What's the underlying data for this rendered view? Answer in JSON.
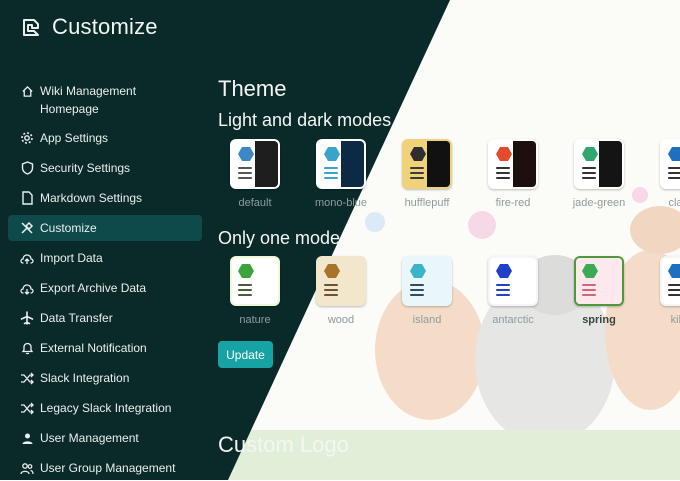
{
  "app": {
    "title": "Customize"
  },
  "sidebar": {
    "items": [
      {
        "label": "Wiki Management Homepage",
        "icon": "home-icon"
      },
      {
        "label": "App Settings",
        "icon": "gear-icon"
      },
      {
        "label": "Security Settings",
        "icon": "shield-icon"
      },
      {
        "label": "Markdown Settings",
        "icon": "file-icon"
      },
      {
        "label": "Customize",
        "icon": "tools-icon",
        "active": true
      },
      {
        "label": "Import Data",
        "icon": "cloud-upload-icon"
      },
      {
        "label": "Export Archive Data",
        "icon": "cloud-download-icon"
      },
      {
        "label": "Data Transfer",
        "icon": "airplane-icon"
      },
      {
        "label": "External Notification",
        "icon": "bell-icon"
      },
      {
        "label": "Slack Integration",
        "icon": "shuffle-icon"
      },
      {
        "label": "Legacy Slack Integration",
        "icon": "shuffle-icon"
      },
      {
        "label": "User Management",
        "icon": "user-icon"
      },
      {
        "label": "User Group Management",
        "icon": "users-icon"
      }
    ]
  },
  "main": {
    "theme_heading": "Theme",
    "light_dark_heading": "Light and dark modes",
    "one_mode_heading": "Only one mode",
    "custom_logo_heading": "Custom Logo",
    "update_label": "Update",
    "light_dark_themes": [
      {
        "name": "default",
        "hex": "#3d87c6",
        "left": "#ffffff",
        "right": "#1e1e1e",
        "line": "#555555"
      },
      {
        "name": "mono-blue",
        "hex": "#3aa3c9",
        "left": "#ffffff",
        "right": "#0c2a45",
        "line": "#3aa3c9"
      },
      {
        "name": "hufflepuff",
        "hex": "#2e2e2e",
        "left": "#f0d27a",
        "right": "#111111",
        "line": "#3a3a3a"
      },
      {
        "name": "fire-red",
        "hex": "#e34b2c",
        "left": "#ffffff",
        "right": "#1e0f0f",
        "line": "#333333"
      },
      {
        "name": "jade-green",
        "hex": "#2fa76f",
        "left": "#ffffff",
        "right": "#141414",
        "line": "#333333"
      },
      {
        "name": "classic",
        "hex": "#1f6fc1",
        "left": "#ffffff",
        "right": "#1c2b3b",
        "line": "#333333"
      }
    ],
    "one_mode_themes": [
      {
        "name": "nature",
        "hex": "#3ea33b",
        "left": "#ffffff",
        "right": "#ffffff",
        "line": "#4a5a3a",
        "bg": "#eef8d8"
      },
      {
        "name": "wood",
        "hex": "#a8742a",
        "left": "#f2e6cc",
        "right": "#f2e6cc",
        "line": "#6d5230",
        "bg": "#f2e6cc"
      },
      {
        "name": "island",
        "hex": "#3bb3c8",
        "left": "#e9f7fa",
        "right": "#e9f7fa",
        "line": "#2f4f5f",
        "bg": "#e9f7fa"
      },
      {
        "name": "antarctic",
        "hex": "#2241c9",
        "left": "#ffffff",
        "right": "#ffffff",
        "line": "#2241c9",
        "bg": "#f3f5fb"
      },
      {
        "name": "spring",
        "hex": "#3caa52",
        "left": "#fde8ee",
        "right": "#fde8ee",
        "line": "#d0657d",
        "bg": "#fde8ee",
        "selected": true
      },
      {
        "name": "kibela",
        "hex": "#1f6fc1",
        "left": "#ffffff",
        "right": "#ffffff",
        "line": "#333333",
        "bg": "#f5f5f5"
      }
    ]
  },
  "colors": {
    "sidebar_bg": "#0a2a2a",
    "active_bg": "#0f4a4a",
    "accent": "#17a2a3",
    "selected_border": "#4c9a3c"
  }
}
